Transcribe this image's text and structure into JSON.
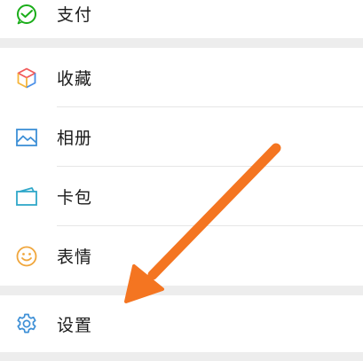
{
  "menu": {
    "pay": {
      "label": "支付",
      "icon": "wechat-pay-icon"
    },
    "favorites": {
      "label": "收藏",
      "icon": "cube-favorites-icon"
    },
    "album": {
      "label": "相册",
      "icon": "photo-album-icon"
    },
    "cards": {
      "label": "卡包",
      "icon": "card-wallet-icon"
    },
    "stickers": {
      "label": "表情",
      "icon": "smiley-face-icon"
    },
    "settings": {
      "label": "设置",
      "icon": "gear-icon"
    }
  },
  "annotation": {
    "arrow_color": "#f47521"
  }
}
